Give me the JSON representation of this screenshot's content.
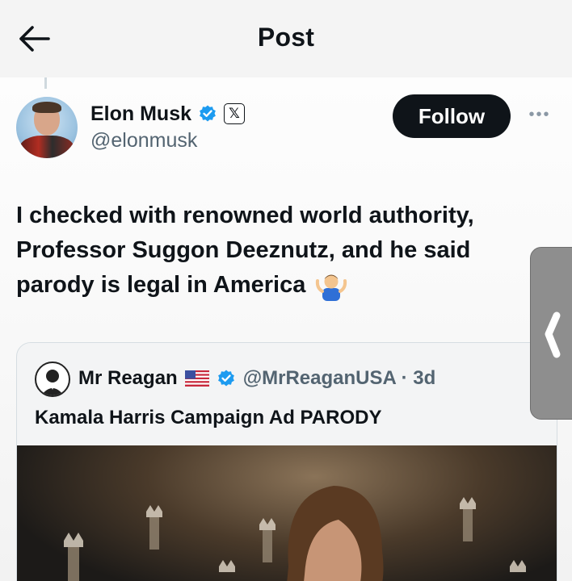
{
  "header": {
    "title": "Post",
    "back_icon": "arrow-left-icon"
  },
  "post": {
    "author": {
      "name": "Elon Musk",
      "handle": "@elonmusk",
      "verified_color": "#1d9bf0",
      "affiliate_badge": "𝕏"
    },
    "follow_label": "Follow",
    "more_label": "•••",
    "text": "I checked with renowned world authority, Professor Suggon Deeznutz, and he said parody is legal in America",
    "emoji_icon": "shrug-emoji-icon"
  },
  "quoted_post": {
    "author": {
      "name": "Mr Reagan",
      "flag_icon": "us-flag-icon",
      "handle_time": "@MrReaganUSA · 3d"
    },
    "text": "Kamala Harris Campaign Ad PARODY"
  },
  "overlay": {
    "side_tab_icon": "chevron-left-icon"
  }
}
